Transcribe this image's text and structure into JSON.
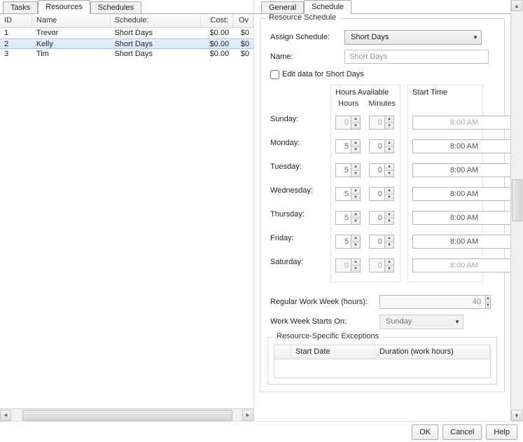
{
  "left_tabs": {
    "tasks": "Tasks",
    "resources": "Resources",
    "schedules": "Schedules",
    "active": "Resources"
  },
  "right_tabs": {
    "general": "General",
    "schedule": "Schedule",
    "active": "Schedule"
  },
  "grid": {
    "headers": {
      "id": "ID",
      "name": "Name",
      "schedule": "Schedule:",
      "cost": "Cost:",
      "ov": "Ov"
    },
    "rows": [
      {
        "id": "1",
        "name": "Trevor",
        "schedule": "Short Days",
        "cost": "$0.00",
        "ov": "$0",
        "selected": false
      },
      {
        "id": "2",
        "name": "Kelly",
        "schedule": "Short Days",
        "cost": "$0.00",
        "ov": "$0",
        "selected": true
      },
      {
        "id": "3",
        "name": "Tim",
        "schedule": "Short Days",
        "cost": "$0.00",
        "ov": "$0",
        "selected": false
      }
    ]
  },
  "fieldset_title": "Resource Schedule",
  "assign": {
    "label": "Assign Schedule:",
    "value": "Short Days"
  },
  "name_field": {
    "label": "Name:",
    "value": "Short Days"
  },
  "editdata": {
    "label": "Edit data for Short Days",
    "checked": false
  },
  "hours_available": "Hours Available",
  "hours_head": "Hours",
  "minutes_head": "Minutes",
  "start_time": "Start Time",
  "days": [
    {
      "label": "Sunday:",
      "hours": "0",
      "mins": "0",
      "start": "8:00 AM",
      "enabled": false
    },
    {
      "label": "Monday:",
      "hours": "5",
      "mins": "0",
      "start": "8:00 AM",
      "enabled": true
    },
    {
      "label": "Tuesday:",
      "hours": "5",
      "mins": "0",
      "start": "8:00 AM",
      "enabled": true
    },
    {
      "label": "Wednesday:",
      "hours": "5",
      "mins": "0",
      "start": "8:00 AM",
      "enabled": true
    },
    {
      "label": "Thursday:",
      "hours": "5",
      "mins": "0",
      "start": "8:00 AM",
      "enabled": true
    },
    {
      "label": "Friday:",
      "hours": "5",
      "mins": "0",
      "start": "8:00 AM",
      "enabled": true
    },
    {
      "label": "Saturday:",
      "hours": "0",
      "mins": "0",
      "start": "8:00 AM",
      "enabled": false
    }
  ],
  "regular_week": {
    "label": "Regular Work Week (hours):",
    "value": "40"
  },
  "week_starts": {
    "label": "Work Week Starts On:",
    "value": "Sunday"
  },
  "exceptions": {
    "title": "Resource-Specific Exceptions",
    "col_start": "Start Date",
    "col_dur": "Duration (work hours)"
  },
  "buttons": {
    "ok": "OK",
    "cancel": "Cancel",
    "help": "Help"
  }
}
